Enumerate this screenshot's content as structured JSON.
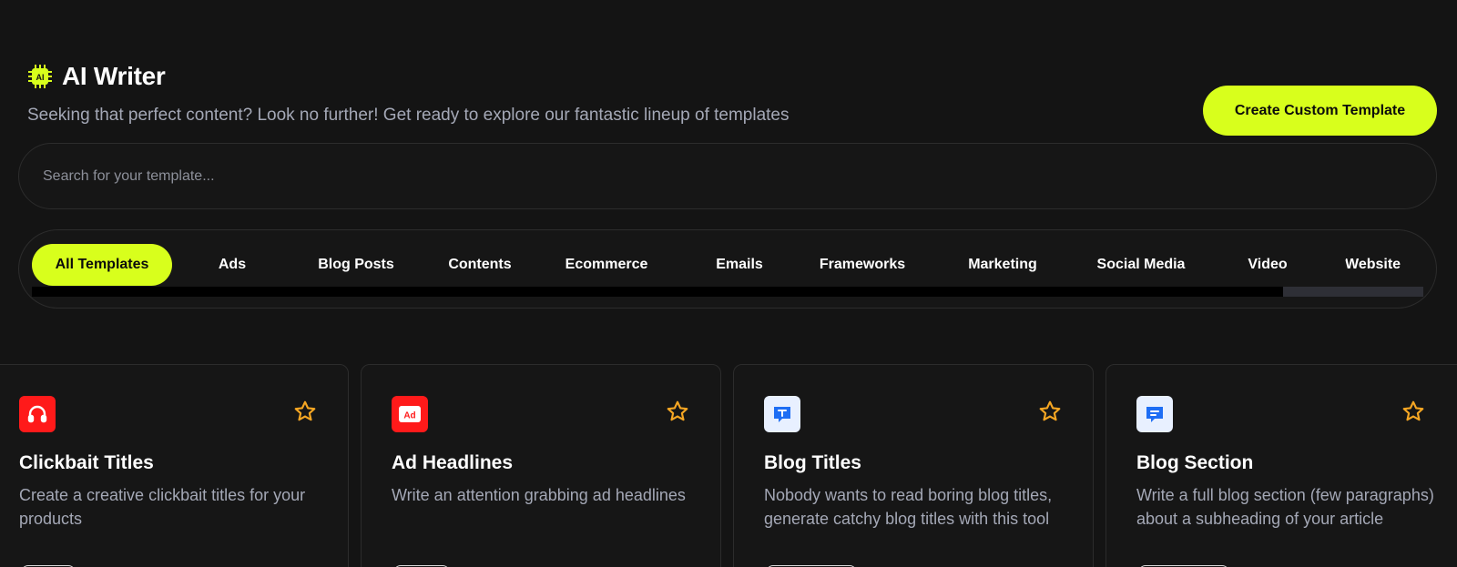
{
  "header": {
    "badge_text": "AI",
    "title": "AI Writer",
    "subtitle": "Seeking that perfect content? Look no further! Get ready to explore our fantastic lineup of templates",
    "create_button_label": "Create Custom Template"
  },
  "search": {
    "placeholder": "Search for your template..."
  },
  "tabs": [
    {
      "label": "All Templates",
      "active": true
    },
    {
      "label": "Ads"
    },
    {
      "label": "Blog Posts"
    },
    {
      "label": "Contents"
    },
    {
      "label": "Ecommerce"
    },
    {
      "label": "Emails"
    },
    {
      "label": "Frameworks"
    },
    {
      "label": "Marketing"
    },
    {
      "label": "Social Media"
    },
    {
      "label": "Video"
    },
    {
      "label": "Website"
    }
  ],
  "cards": [
    {
      "icon": "headphones-icon",
      "title": "Clickbait Titles",
      "description": "Create a creative clickbait titles for your products"
    },
    {
      "icon": "ad-icon",
      "title": "Ad Headlines",
      "description": "Write an attention grabbing ad headlines"
    },
    {
      "icon": "text-bubble-icon",
      "title": "Blog Titles",
      "description": "Nobody wants to read boring blog titles, generate catchy blog titles with this tool"
    },
    {
      "icon": "message-bubble-icon",
      "title": "Blog Section",
      "description": "Write a full blog section (few paragraphs) about a subheading of your article"
    }
  ],
  "colors": {
    "accent": "#d8ff1c",
    "background": "#141414",
    "muted_text": "#a4a8b6",
    "star": "#f5a623",
    "red_icon_bg": "#ff1a1a",
    "blue_icon_bg": "#e8f0ff",
    "blue_icon": "#1e6ef4"
  }
}
